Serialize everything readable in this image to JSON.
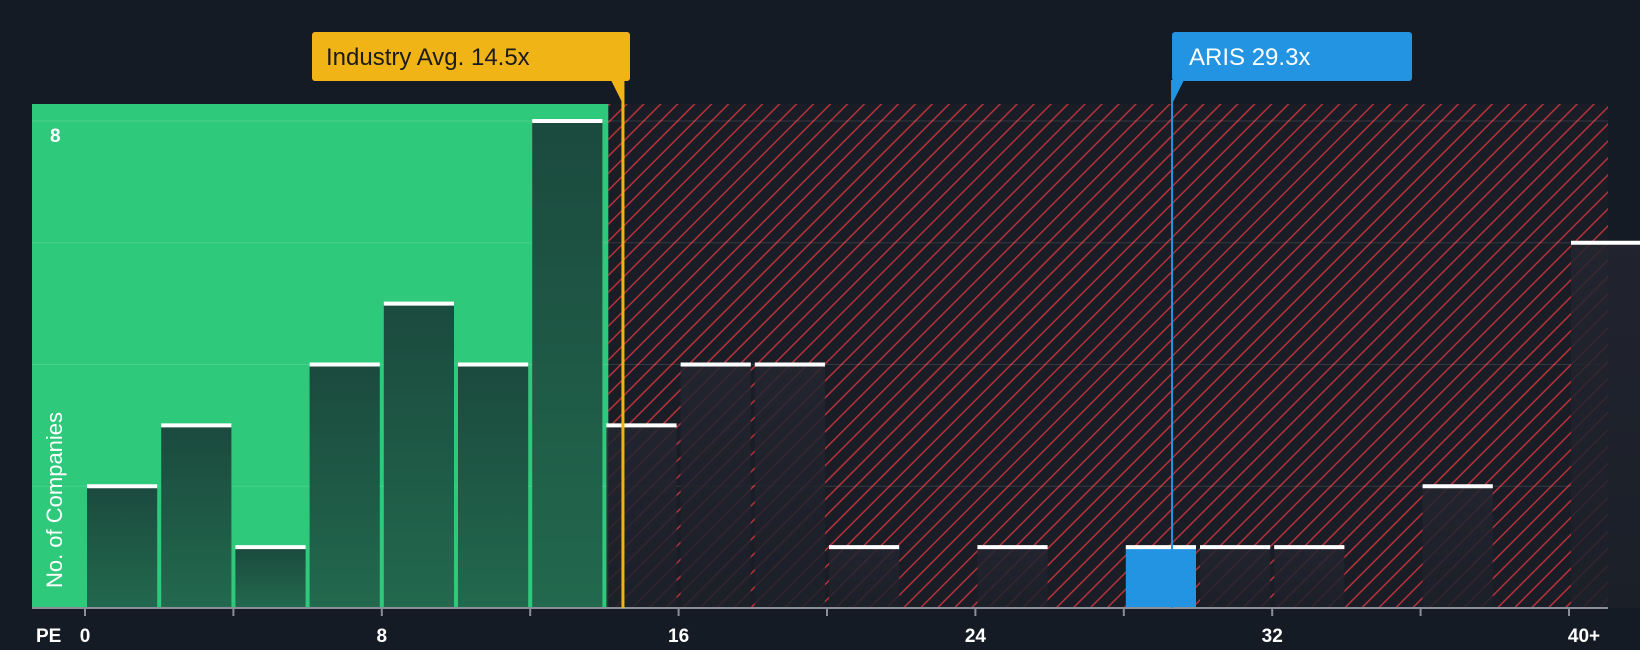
{
  "chart_data": {
    "type": "bar",
    "title": "",
    "xlabel": "PE",
    "ylabel": "No. of Companies",
    "x_ticks": [
      "0",
      "8",
      "16",
      "24",
      "32",
      "40+"
    ],
    "y_ticks": [
      "8"
    ],
    "bin_width": 2,
    "xlim": [
      0,
      41
    ],
    "ylim": [
      0,
      8
    ],
    "bins": [
      {
        "x": 0,
        "value": 2
      },
      {
        "x": 2,
        "value": 3
      },
      {
        "x": 4,
        "value": 1
      },
      {
        "x": 6,
        "value": 4
      },
      {
        "x": 8,
        "value": 5
      },
      {
        "x": 10,
        "value": 4
      },
      {
        "x": 12,
        "value": 8
      },
      {
        "x": 14,
        "value": 3
      },
      {
        "x": 16,
        "value": 4
      },
      {
        "x": 18,
        "value": 4
      },
      {
        "x": 20,
        "value": 1
      },
      {
        "x": 22,
        "value": 0
      },
      {
        "x": 24,
        "value": 1
      },
      {
        "x": 26,
        "value": 0
      },
      {
        "x": 28,
        "value": 1,
        "highlight": true
      },
      {
        "x": 30,
        "value": 1
      },
      {
        "x": 32,
        "value": 1
      },
      {
        "x": 34,
        "value": 0
      },
      {
        "x": 36,
        "value": 2
      },
      {
        "x": 38,
        "value": 0
      },
      {
        "x": 40,
        "value": 6
      }
    ],
    "industry_avg": {
      "label": "Industry Avg. 14.5x",
      "value": 14.5
    },
    "company": {
      "label": "ARIS 29.3x",
      "value": 29.3
    },
    "colors": {
      "background": "#151b24",
      "undervalued_zone": "#2fc97c",
      "bar_in_zone": "#1e4b3e",
      "bar_outside": "#1f2530",
      "overvalued_stripe": "#c8343c",
      "industry": "#f0b416",
      "company": "#2394e2",
      "bar_top": "#ffffff"
    }
  }
}
